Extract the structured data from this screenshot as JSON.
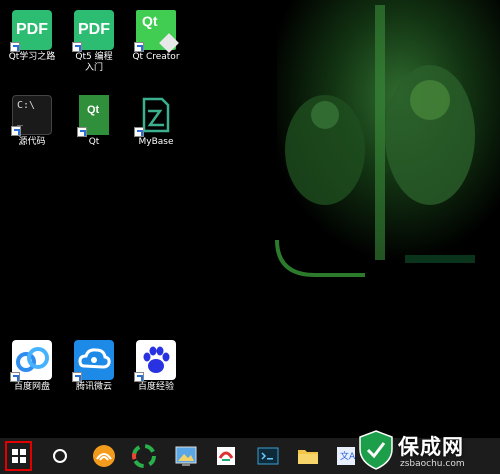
{
  "desktop": {
    "icons": [
      {
        "label": "Qt学习之路",
        "tile_text": "PDF",
        "icon": "pdf-icon"
      },
      {
        "label": "Qt5 编程入门",
        "tile_text": "PDF",
        "icon": "pdf-icon"
      },
      {
        "label": "Qt Creator",
        "tile_text": "Qt",
        "icon": "qt-creator-icon"
      },
      {
        "label": "源代码",
        "tile_text": "C:\\",
        "icon": "cmd-icon"
      },
      {
        "label": "Qt",
        "tile_text": "Qt",
        "icon": "qt-icon"
      },
      {
        "label": "MyBase",
        "icon": "mybase-icon"
      },
      {
        "label": "百度网盘",
        "icon": "baidu-netdisk-icon"
      },
      {
        "label": "腾讯微云",
        "icon": "weiyun-icon"
      },
      {
        "label": "百度经验",
        "icon": "baidu-paw-icon"
      }
    ]
  },
  "taskbar": {
    "items": [
      "windows-start-icon",
      "cortana-search-icon",
      "browser-icon",
      "app-icon",
      "image-viewer-icon",
      "office-icon",
      "terminal-icon",
      "file-explorer-icon",
      "translate-icon"
    ]
  },
  "watermark": {
    "title": "保成网",
    "url": "zsbaochu.com"
  },
  "colors": {
    "pdf_green": "#2dbd72",
    "qt_green": "#41cd52",
    "highlight_red": "#e10000",
    "taskbar": "#1c1c1c"
  }
}
